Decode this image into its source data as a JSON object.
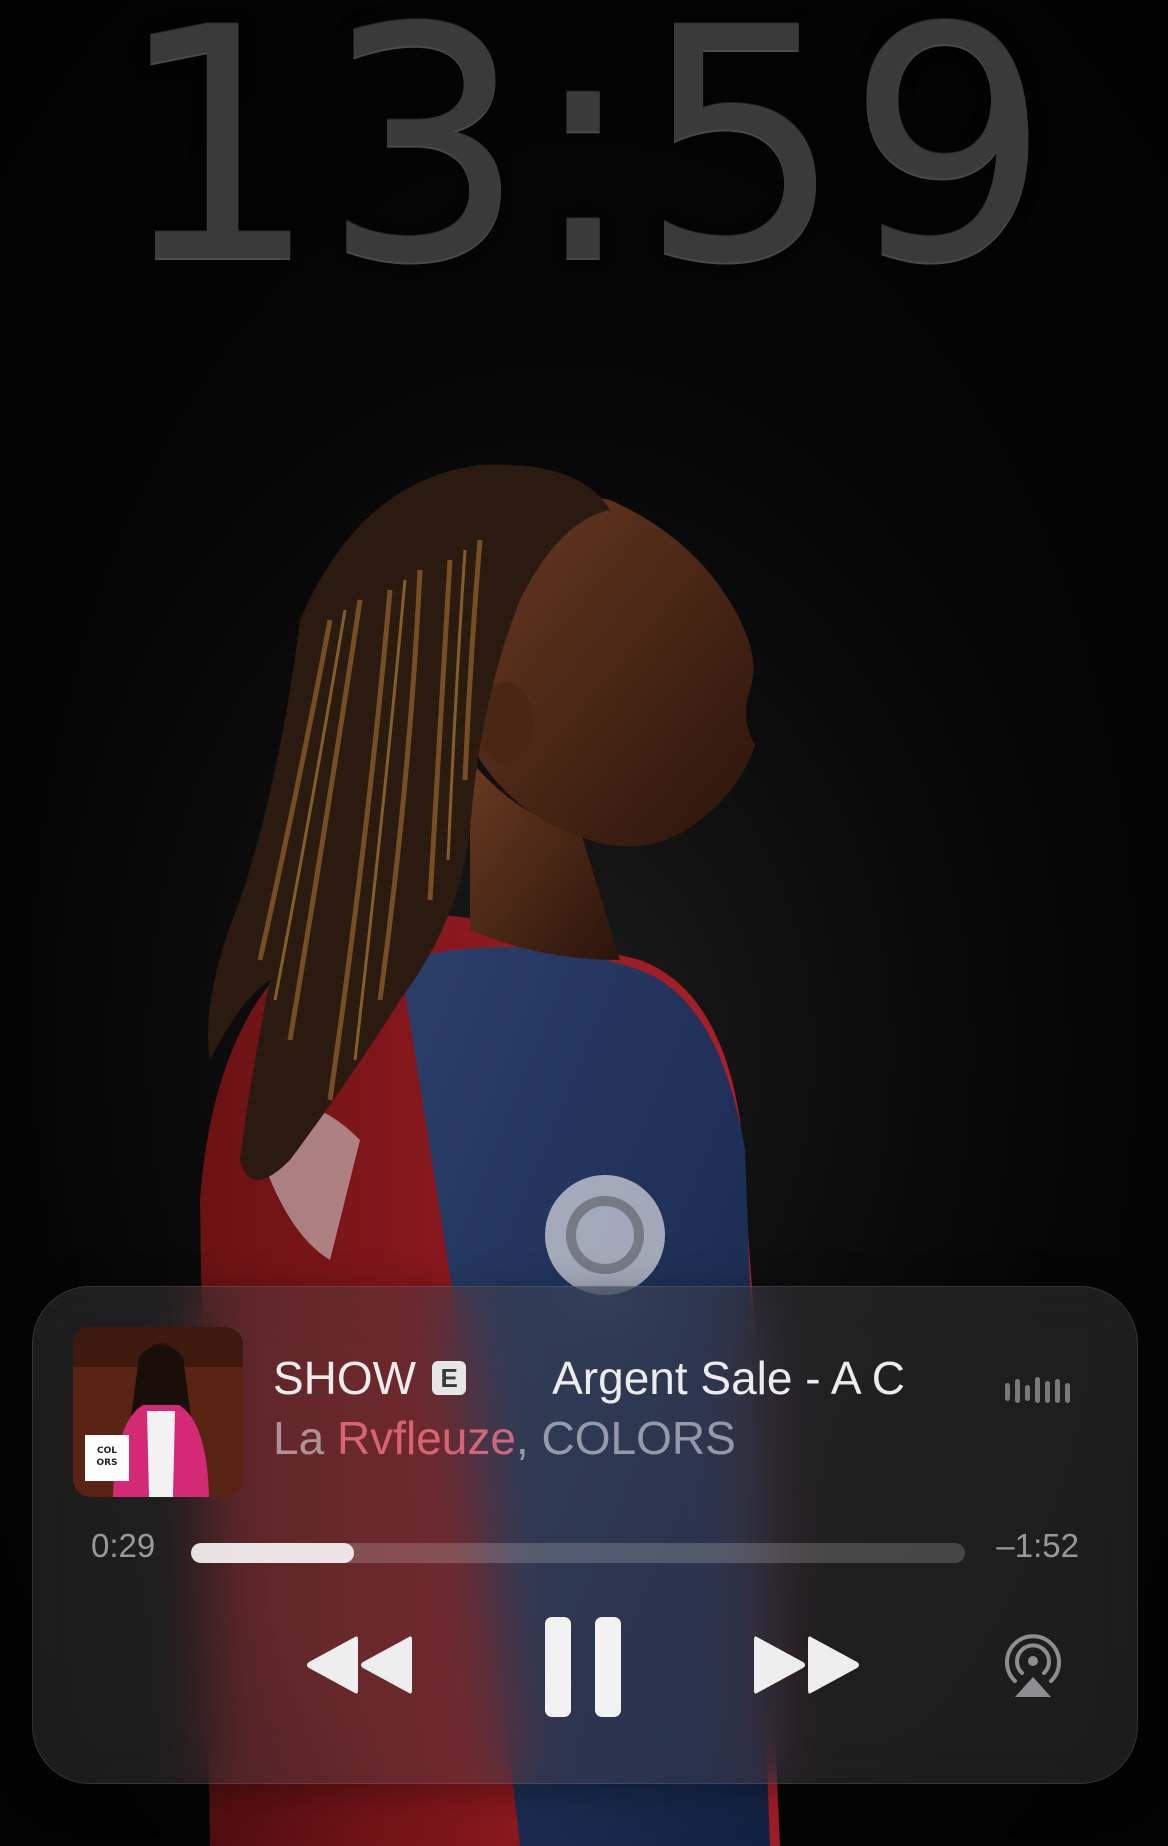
{
  "lock_screen": {
    "time": "13:59"
  },
  "now_playing": {
    "title": "SHOW",
    "explicit_badge": "E",
    "title_continuation": "Argent Sale - A C",
    "artist_part1": "La ",
    "artist_part2": "Rvfleuze",
    "artist_part3": ", COLORS",
    "artwork_label_line1": "COL",
    "artwork_label_line2": "ORS",
    "elapsed": "0:29",
    "remaining": "–1:52",
    "progress": 0.21
  },
  "icons": {
    "rewind": "backward-icon",
    "pause": "pause-icon",
    "forward": "forward-icon",
    "airplay": "airplay-icon",
    "waveform": "waveform-icon"
  }
}
